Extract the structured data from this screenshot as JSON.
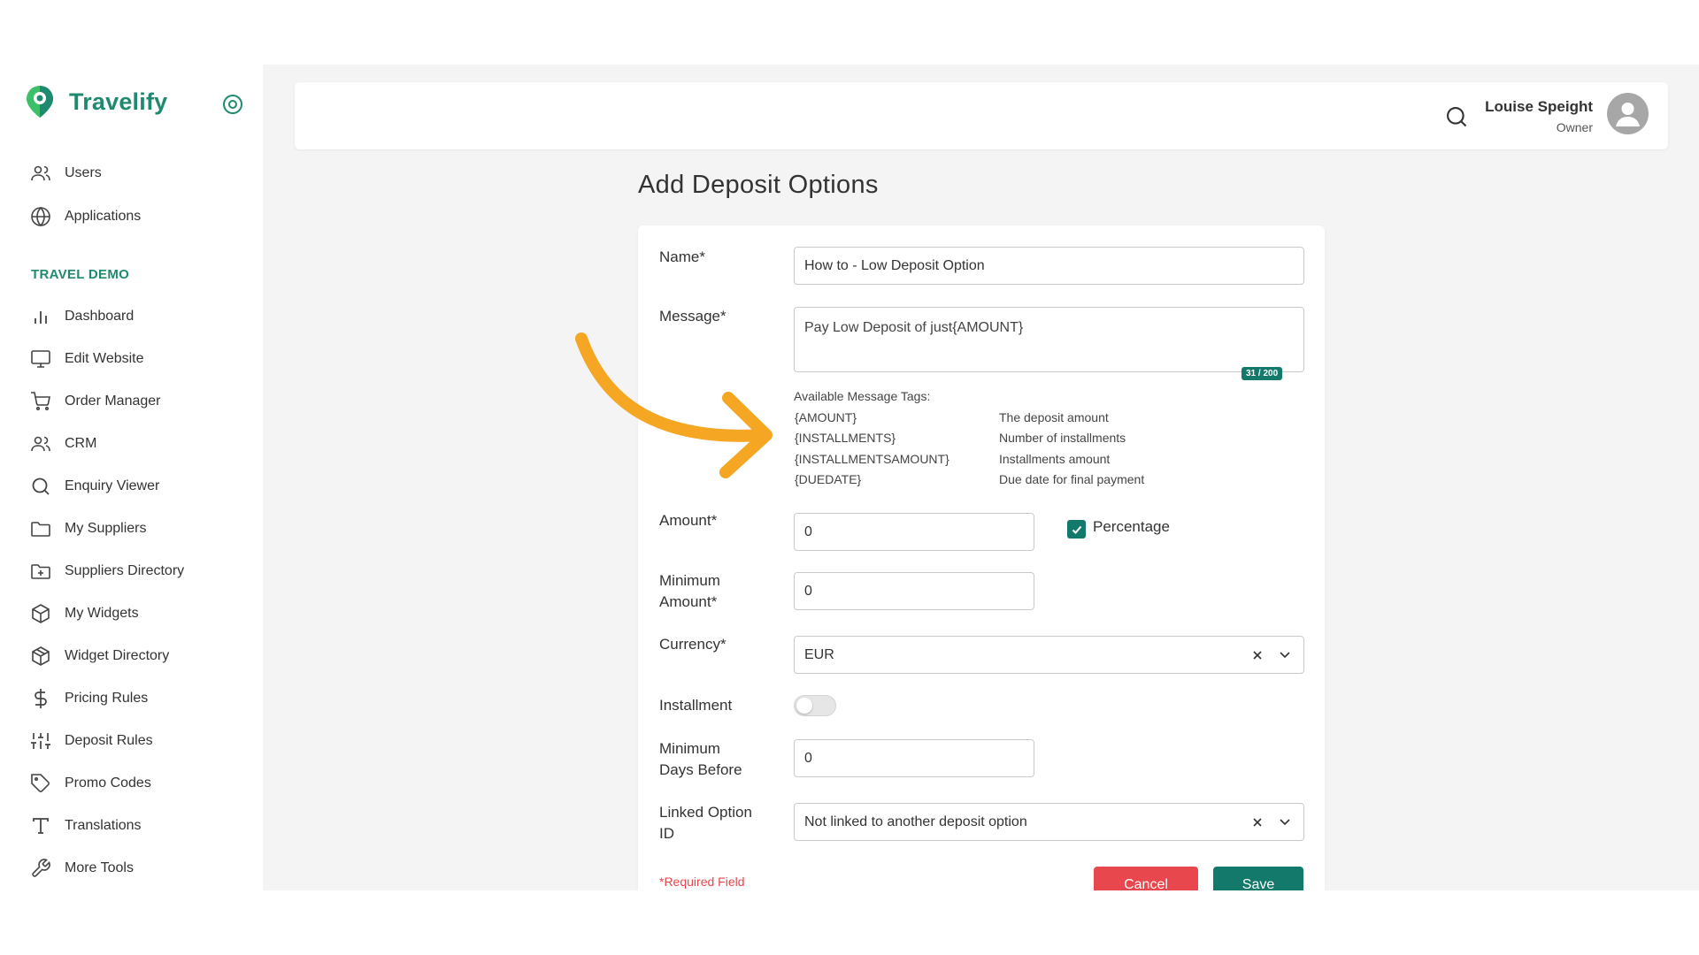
{
  "brand": {
    "name": "Travelify",
    "accent": "#1f8a70"
  },
  "sidebar": {
    "top_items": [
      {
        "label": "Users",
        "icon": "users-icon"
      },
      {
        "label": "Applications",
        "icon": "globe-icon"
      }
    ],
    "section_label": "TRAVEL DEMO",
    "items": [
      {
        "label": "Dashboard",
        "icon": "bar-chart-icon"
      },
      {
        "label": "Edit Website",
        "icon": "monitor-icon"
      },
      {
        "label": "Order Manager",
        "icon": "cart-icon"
      },
      {
        "label": "CRM",
        "icon": "users-icon"
      },
      {
        "label": "Enquiry Viewer",
        "icon": "search-icon"
      },
      {
        "label": "My Suppliers",
        "icon": "folder-icon"
      },
      {
        "label": "Suppliers Directory",
        "icon": "folder-plus-icon"
      },
      {
        "label": "My Widgets",
        "icon": "box-icon"
      },
      {
        "label": "Widget Directory",
        "icon": "boxes-icon"
      },
      {
        "label": "Pricing Rules",
        "icon": "dollar-icon"
      },
      {
        "label": "Deposit Rules",
        "icon": "sliders-icon"
      },
      {
        "label": "Promo Codes",
        "icon": "tag-icon"
      },
      {
        "label": "Translations",
        "icon": "type-icon"
      },
      {
        "label": "More Tools",
        "icon": "wrench-icon"
      }
    ]
  },
  "header": {
    "user_name": "Louise Speight",
    "user_role": "Owner"
  },
  "page": {
    "title": "Add Deposit Options"
  },
  "form": {
    "name_label": "Name*",
    "name_value": "How to - Low Deposit Option",
    "message_label": "Message*",
    "message_value": "Pay Low Deposit of just{AMOUNT}",
    "message_counter": "31 / 200",
    "tags_title": "Available Message Tags:",
    "tags": [
      {
        "tag": "{AMOUNT}",
        "desc": "The deposit amount"
      },
      {
        "tag": "{INSTALLMENTS}",
        "desc": "Number of installments"
      },
      {
        "tag": "{INSTALLMENTSAMOUNT}",
        "desc": "Installments amount"
      },
      {
        "tag": "{DUEDATE}",
        "desc": "Due date for final payment"
      }
    ],
    "amount_label": "Amount*",
    "amount_value": "0",
    "percentage_label": "Percentage",
    "percentage_checked": true,
    "min_amount_label_1": "Minimum",
    "min_amount_label_2": "Amount*",
    "min_amount_value": "0",
    "currency_label": "Currency*",
    "currency_value": "EUR",
    "installment_label": "Installment",
    "installment_on": false,
    "min_days_label_1": "Minimum",
    "min_days_label_2": "Days Before",
    "min_days_value": "0",
    "linked_label_1": "Linked Option",
    "linked_label_2": "ID",
    "linked_value": "Not linked to another deposit option",
    "required_note": "*Required Field",
    "cancel_label": "Cancel",
    "save_label": "Save"
  },
  "colors": {
    "primary": "#137a6b",
    "danger": "#e8474e",
    "annotation_arrow": "#f5a623"
  }
}
